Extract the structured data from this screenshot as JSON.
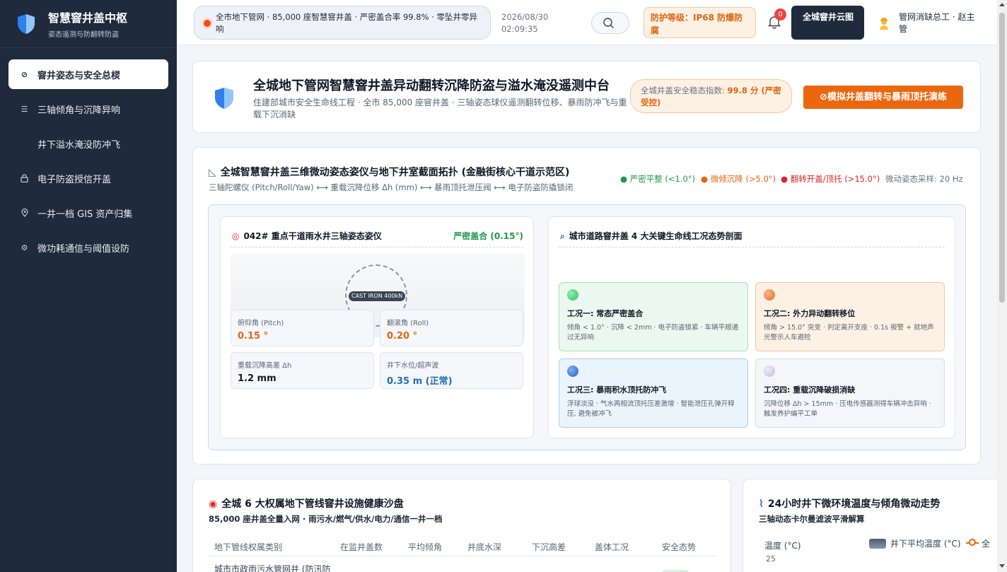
{
  "sidebar": {
    "title": "智慧窨井盖中枢",
    "subtitle": "姿态遥测与防翻转防盗",
    "items": [
      {
        "label": "窨井姿态与安全总棂",
        "icon": "gauge-icon"
      },
      {
        "label": "三轴倾角与沉降异响",
        "icon": "sliders-icon"
      },
      {
        "label": "井下溢水淹没防冲飞",
        "icon": ""
      },
      {
        "label": "电子防盗授信开盖",
        "icon": "lock-icon"
      },
      {
        "label": "一井一档 GIS 资产归集",
        "icon": "map-pin-icon"
      },
      {
        "label": "微功耗通信与阈值设防",
        "icon": "gear-icon"
      }
    ]
  },
  "topbar": {
    "ticker": "全市地下管网 · 85,000 座智慧窨井盖 · 严密盖合率 99.8% · 零坠井零异响",
    "date": "2026/08/30",
    "time": "02:09:35",
    "protection": "防护等级：IP68 防爆防腐",
    "notifications": "0",
    "cloud_button": "全城窨井云图",
    "user": "管网消缺总工 · 赵主管"
  },
  "hero": {
    "title": "全城地下管网智慧窨井盖异动翻转沉降防盗与溢水淹没遥测中台",
    "subtitle": "住建部城市安全生命线工程 · 全市 85,000 座窨井盖 · 三轴姿态球仪遥测翻转位移、暴雨防冲飞与重载下沉消缺",
    "index_label": "全城井盖安全稳态指数:",
    "index_value": "99.8 分 (严密受控)",
    "drill_button": "⊘模拟井盖翻转与暴雨顶托演练"
  },
  "section3d": {
    "title": "全城智慧窨井盖三维微动姿态姿仪与地下井室截面拓扑 (金融街核心干道示范区)",
    "subtitle": "三轴陀螺仪 (Pitch/Roll/Yaw) ⟷ 重载沉降位移 Δh (mm) ⟷ 暴雨顶托泄压阀 ⟷ 电子防盗防撬锁闭",
    "legend": [
      {
        "label": "● 严密平整 (<1.0°)",
        "color": "#1d9a48"
      },
      {
        "label": "● 微倾沉降 (>5.0°)",
        "color": "#e2650f"
      },
      {
        "label": "● 翻转开盖/顶托 (>15.0°)",
        "color": "#dc2626"
      }
    ],
    "sampling": "微动姿态采样: 20 Hz",
    "gyro": {
      "title": "042# 重点干道雨水井三轴姿态姿仪",
      "status": "严密盖合 (0.15°)",
      "cover_label": "CAST IRON 400kN",
      "metrics": [
        {
          "label": "俯仰角 (Pitch)",
          "value": "0.15 °",
          "color": "#e2650f"
        },
        {
          "label": "翻滚角 (Roll)",
          "value": "0.20 °",
          "color": "#e2650f"
        },
        {
          "label": "重载沉降高差 Δh",
          "value": "1.2 mm",
          "color": "#111827"
        },
        {
          "label": "井下水位/超声波",
          "value": "0.35 m (正常)",
          "color": "#1f6fb5"
        }
      ]
    },
    "states": {
      "title": "城市道路窨井盖 4 大关键生命线工况态势剖面",
      "cards": [
        {
          "title": "工况一: 常态严密盖合",
          "desc": "倾角 < 1.0° · 沉降 < 2mm · 电子防盗锁紧 · 车辆平顺通过无异响",
          "bg": "#eaf8ef",
          "border": "#a8dfb9",
          "dot": "#2fbf62"
        },
        {
          "title": "工况二: 外力异动翻转移位",
          "desc": "倾角 > 15.0° 突变 · 判定离开支座 · 0.1s 报警 + 就地声光警示人车避险",
          "bg": "#fdf1e4",
          "border": "#f3c89d",
          "dot": "#ef6a22"
        },
        {
          "title": "工况三: 暴雨积水顶托防冲飞",
          "desc": "浮球淡没 · 气水两相流顶托压差激增 · 智能泄压孔弹开释压, 避免被冲飞",
          "bg": "#eaf4fc",
          "border": "#a9cdee",
          "dot": "#2563c9"
        },
        {
          "title": "工况四: 重载沉降破损消缺",
          "desc": "沉降位移 Δh > 15mm · 压电传感器测得车辆冲击异响 · 触发养护编平工单",
          "bg": "#f4f6f9",
          "border": "#d5dbe4",
          "dot": "#c9b8e0"
        }
      ]
    }
  },
  "health": {
    "title": "全城 6 大权属地下管线窨井设施健康沙盘",
    "subtitle": "85,000 座井盖全量入网 · 雨污水/燃气/供水/电力/通信一井一档",
    "columns": [
      "地下管线权属类别",
      "在监井盖数",
      "平均倾角",
      "井底水深",
      "下沉高差",
      "盖体工况",
      "安全态势"
    ],
    "row1": "城市市政雨污水管网井 (防汛防"
  },
  "trend": {
    "title": "24小时井下微环境温度与倾角微动走势",
    "subtitle": "三轴动态卡尔曼滤波平滑解算",
    "ylabel": "温度 (°C)",
    "legend1": "井下平均温度 (°C)",
    "legend2": "全",
    "tick": "25"
  }
}
